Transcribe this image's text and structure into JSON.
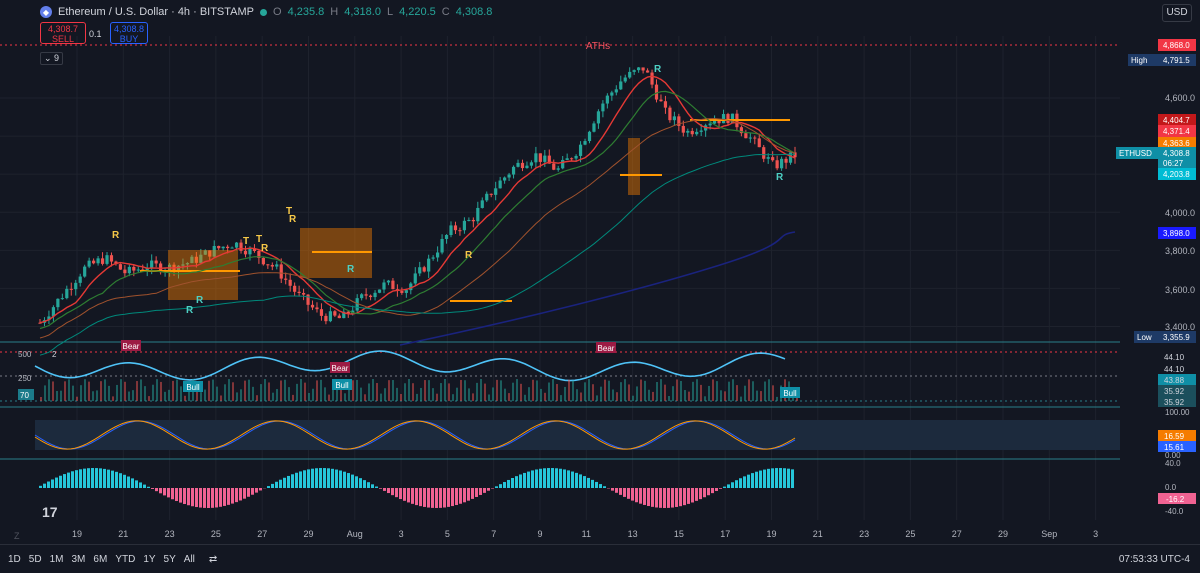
{
  "header": {
    "symbol": "Ethereum / U.S. Dollar · 4h · BITSTAMP",
    "open_label": "O",
    "open": "4,235.8",
    "high_label": "H",
    "high": "4,318.0",
    "low_label": "L",
    "low": "4,220.5",
    "close_label": "C",
    "close": "4,308.8"
  },
  "trade": {
    "sell_price": "4,308.7",
    "sell_label": "SELL",
    "spread": "0.1",
    "buy_price": "4,308.8",
    "buy_label": "BUY"
  },
  "indicator_chip": "9",
  "currency": "USD",
  "price_axis": {
    "ticks": [
      "4,600.0",
      "4,000.0",
      "3,800.0",
      "3,600.0",
      "3,400.0"
    ],
    "ath_label": "ATHs",
    "badges": [
      {
        "label": "",
        "value": "4,868.0",
        "color": "#f23645"
      },
      {
        "label": "High",
        "value": "4,791.5",
        "color": "#1e3a66"
      },
      {
        "label": "",
        "value": "4,404.7",
        "color": "#c2181a"
      },
      {
        "label": "",
        "value": "4,371.4",
        "color": "#f23645"
      },
      {
        "label": "",
        "value": "4,363.6",
        "color": "#f57c00"
      },
      {
        "label": "ETHUSD",
        "value": "4,308.8",
        "color": "#0f8fa6"
      },
      {
        "label": "",
        "value": "06:27",
        "color": "#0f8fa6"
      },
      {
        "label": "",
        "value": "4,203.8",
        "color": "#00bcd4"
      },
      {
        "label": "",
        "value": "3,898.0",
        "color": "#1a1aff"
      },
      {
        "label": "Low",
        "value": "3,355.9",
        "color": "#1e3a66"
      }
    ]
  },
  "pane2": {
    "chip": "2",
    "ticks": [
      "500",
      "250"
    ],
    "badges": [
      "44.10",
      "44.10",
      "43.88",
      "35.92",
      "35.92"
    ],
    "left_badge": "70",
    "labels": [
      "Bear",
      "Bull",
      "Bear",
      "Bull",
      "Bear",
      "Bull"
    ]
  },
  "pane3": {
    "ticks": [
      "100.00"
    ],
    "badges": [
      "16.59",
      "15.61"
    ],
    "bottom_tick": "0.00"
  },
  "pane4": {
    "ticks": [
      "40.0",
      "0.0",
      "-40.0"
    ],
    "badge": "-16.2"
  },
  "signal_labels": [
    "R",
    "T",
    "R",
    "T",
    "T",
    "R",
    "R",
    "R",
    "R",
    "R",
    "R",
    "R"
  ],
  "x_axis": [
    "19",
    "21",
    "23",
    "25",
    "27",
    "29",
    "Aug",
    "3",
    "5",
    "7",
    "9",
    "11",
    "13",
    "15",
    "17",
    "19",
    "21",
    "23",
    "25",
    "27",
    "29",
    "Sep",
    "3"
  ],
  "ranges": [
    "1D",
    "5D",
    "1M",
    "3M",
    "6M",
    "YTD",
    "1Y",
    "5Y",
    "All"
  ],
  "clock": "07:53:33 UTC-4",
  "chart_data": {
    "type": "candlestick",
    "x_labels": [
      "19",
      "21",
      "23",
      "25",
      "27",
      "29",
      "Aug",
      "3",
      "5",
      "7",
      "9",
      "11",
      "13",
      "15",
      "17",
      "19"
    ],
    "close_path": [
      3420,
      3560,
      3700,
      3760,
      3680,
      3720,
      3710,
      3740,
      3800,
      3840,
      3780,
      3700,
      3560,
      3460,
      3440,
      3560,
      3620,
      3600,
      3740,
      3900,
      3960,
      4120,
      4240,
      4300,
      4220,
      4340,
      4560,
      4700,
      4760,
      4520,
      4420,
      4480,
      4500,
      4380,
      4240,
      4300
    ],
    "axis_ticks": [
      4600,
      4000,
      3800,
      3600,
      3400
    ],
    "high": 4791.5,
    "low": 3355.9,
    "ath": 4868.0,
    "last": 4308.8
  }
}
